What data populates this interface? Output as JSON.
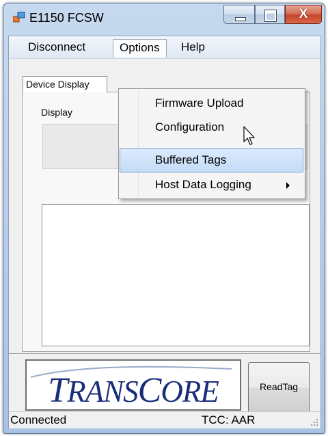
{
  "window": {
    "title": "E1150 FCSW",
    "controls": {
      "minimize": "minimize",
      "maximize": "maximize",
      "close": "X"
    }
  },
  "menubar": {
    "items": [
      "Disconnect",
      "Options",
      "Help"
    ],
    "open_menu": "Options"
  },
  "options_menu": {
    "items": [
      "Firmware Upload",
      "Configuration",
      "Buffered Tags",
      "Host Data Logging"
    ],
    "highlighted": "Buffered Tags",
    "submenu_on": "Host Data Logging"
  },
  "tabs": [
    "Device Display"
  ],
  "display": {
    "group_label": "Display"
  },
  "logo": {
    "text_lead": "T",
    "text_mid": "RANS",
    "text_c": "C",
    "text_end": "ORE",
    "brand_color": "#1a2d7a"
  },
  "buttons": {
    "read_tag": "ReadTag"
  },
  "status": {
    "connection": "Connected",
    "tcc": "TCC: AAR"
  },
  "colors": {
    "title_bar": "#b9cfea",
    "menu_highlight": "#c3dcf7",
    "close_button": "#c7452a"
  }
}
